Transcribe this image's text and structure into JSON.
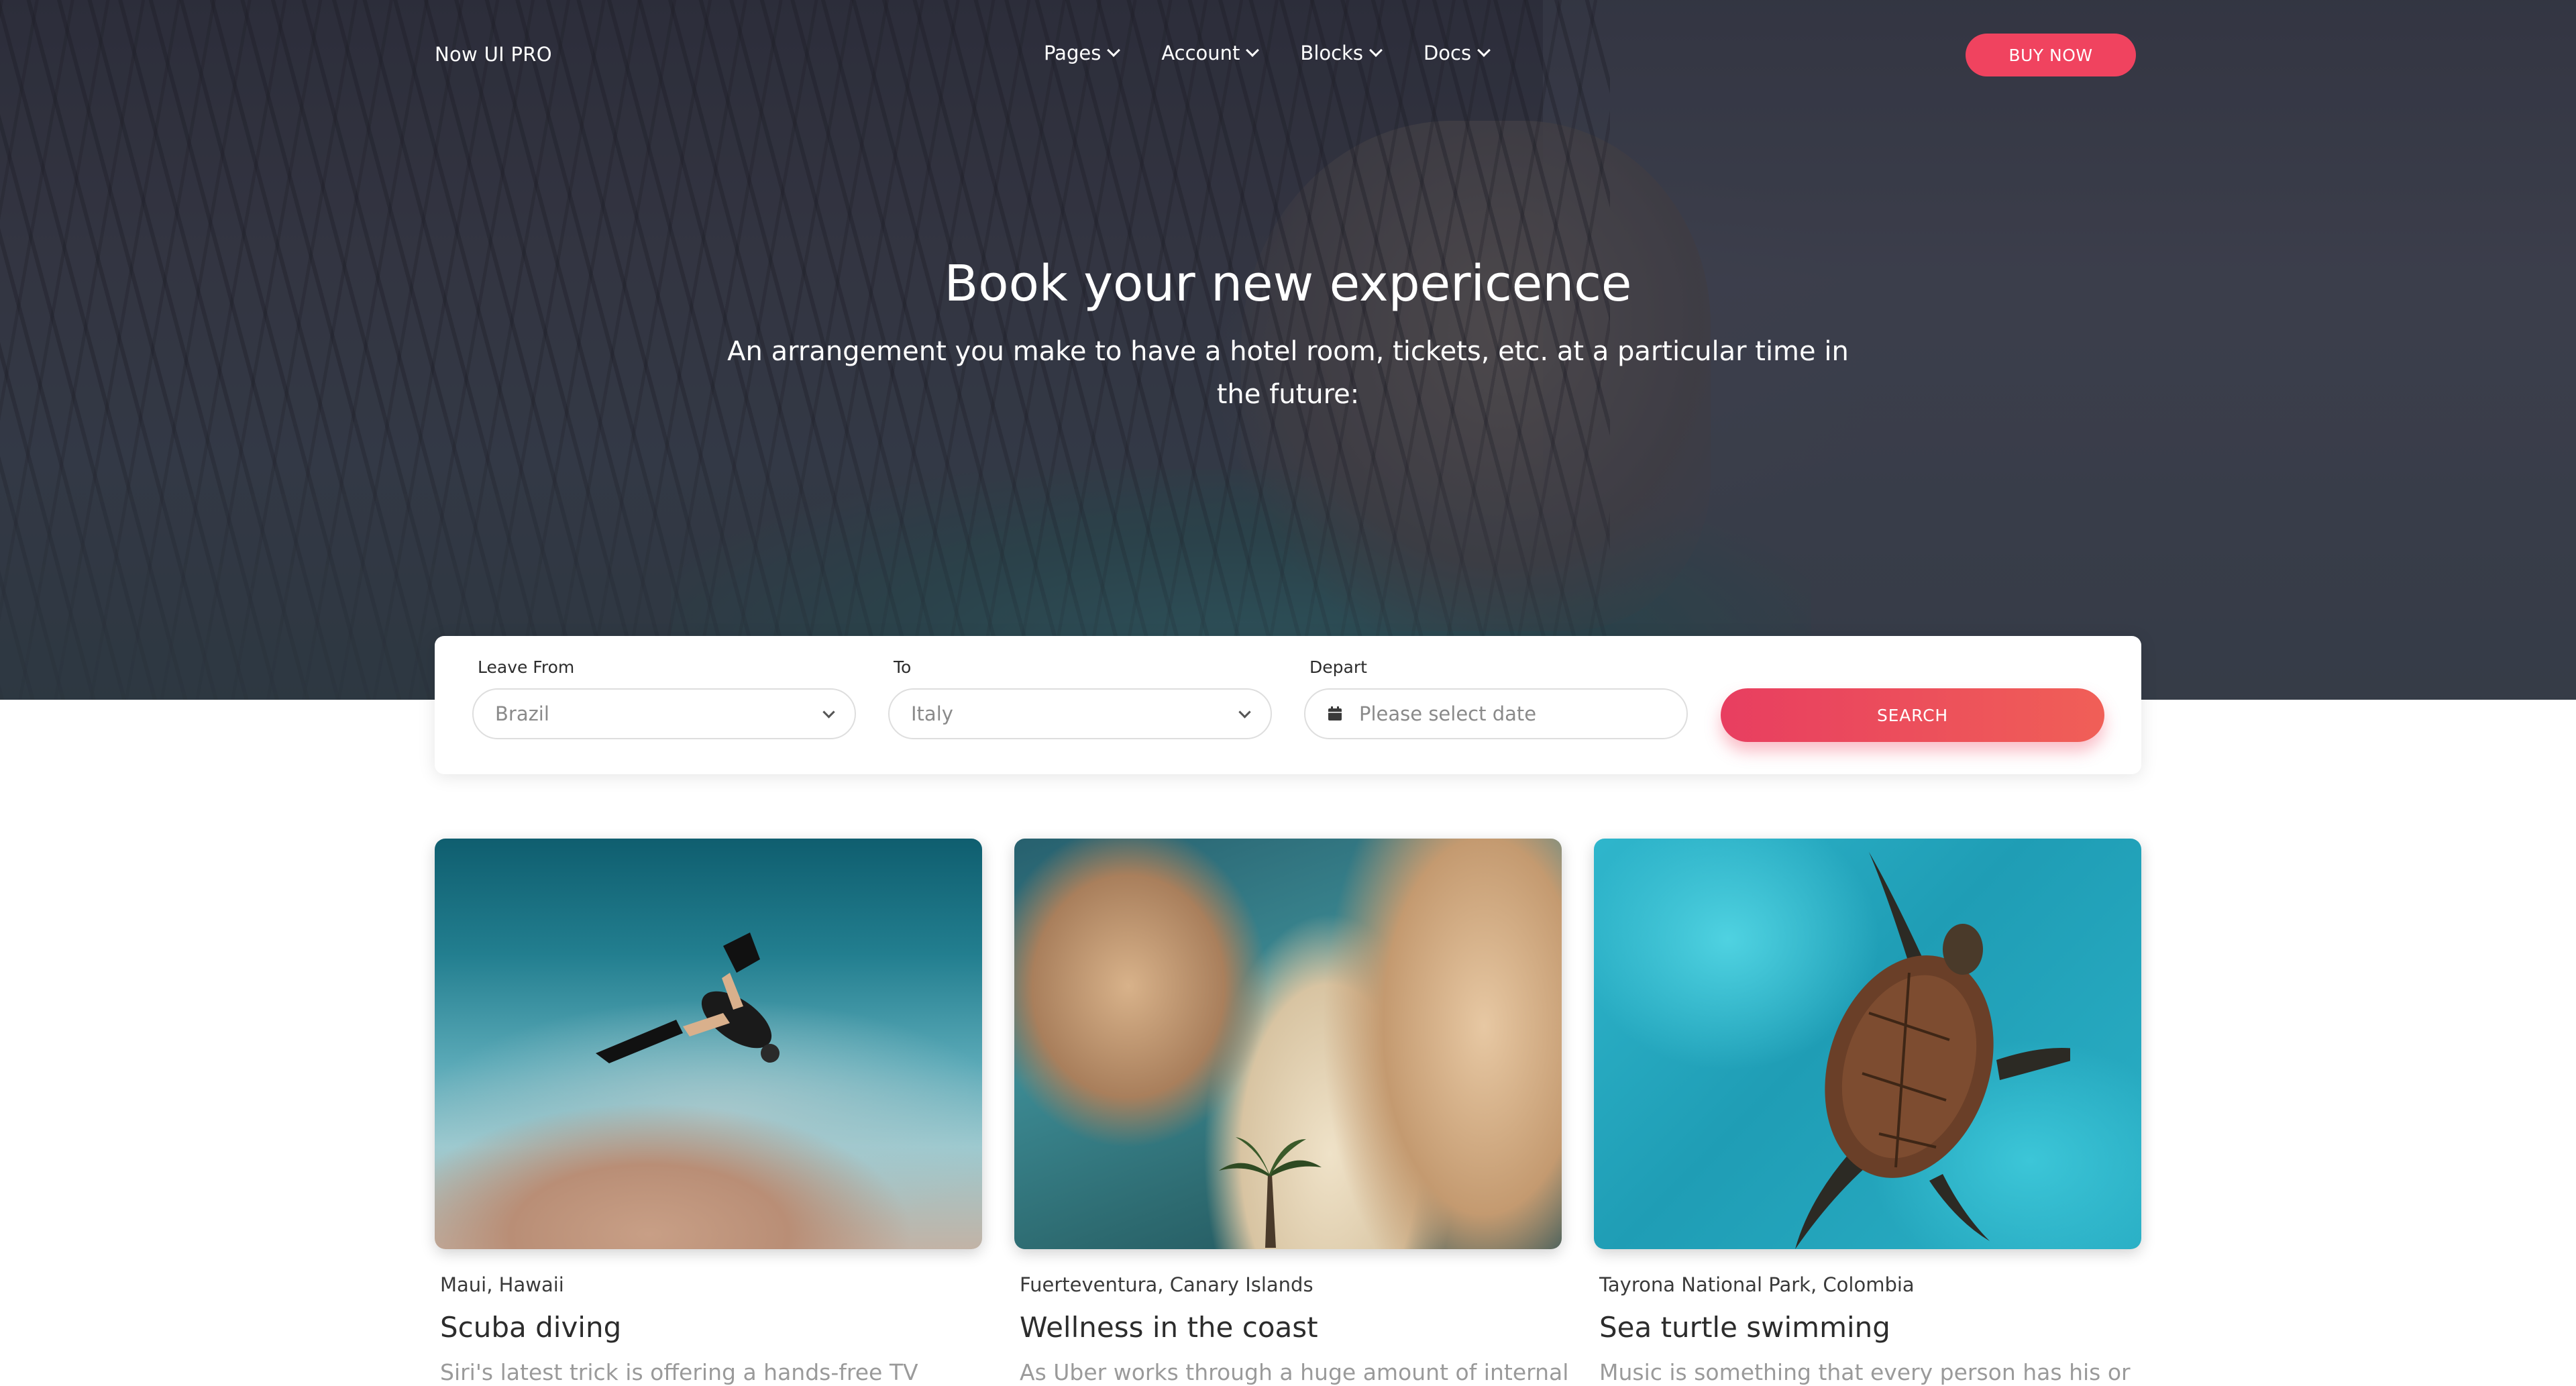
{
  "navbar": {
    "brand": "Now UI PRO",
    "menu": [
      {
        "label": "Pages"
      },
      {
        "label": "Account"
      },
      {
        "label": "Blocks"
      },
      {
        "label": "Docs"
      }
    ],
    "buy_label": "BUY NOW"
  },
  "hero": {
    "title": "Book your new expericence",
    "subtitle": "An arrangement you make to have a hotel room, tickets, etc. at a particular time in the future:"
  },
  "search": {
    "leave_from": {
      "label": "Leave From",
      "value": "Brazil"
    },
    "to": {
      "label": "To",
      "value": "Italy"
    },
    "depart": {
      "label": "Depart",
      "placeholder": "Please select date"
    },
    "button_label": "SEARCH"
  },
  "cards": [
    {
      "location": "Maui, Hawaii",
      "title": "Scuba diving",
      "excerpt": "Siri's latest trick is offering a hands-free TV"
    },
    {
      "location": "Fuerteventura, Canary Islands",
      "title": "Wellness in the coast",
      "excerpt": "As Uber works through a huge amount of internal"
    },
    {
      "location": "Tayrona National Park, Colombia",
      "title": "Sea turtle swimming",
      "excerpt": "Music is something that every person has his or"
    }
  ],
  "colors": {
    "accent": "#f0435f",
    "hero_overlay": "#2c2c3a"
  },
  "icons": {
    "nav_dropdown": "chevron-down-icon",
    "select_dropdown": "chevron-down-icon",
    "date": "calendar-icon"
  }
}
